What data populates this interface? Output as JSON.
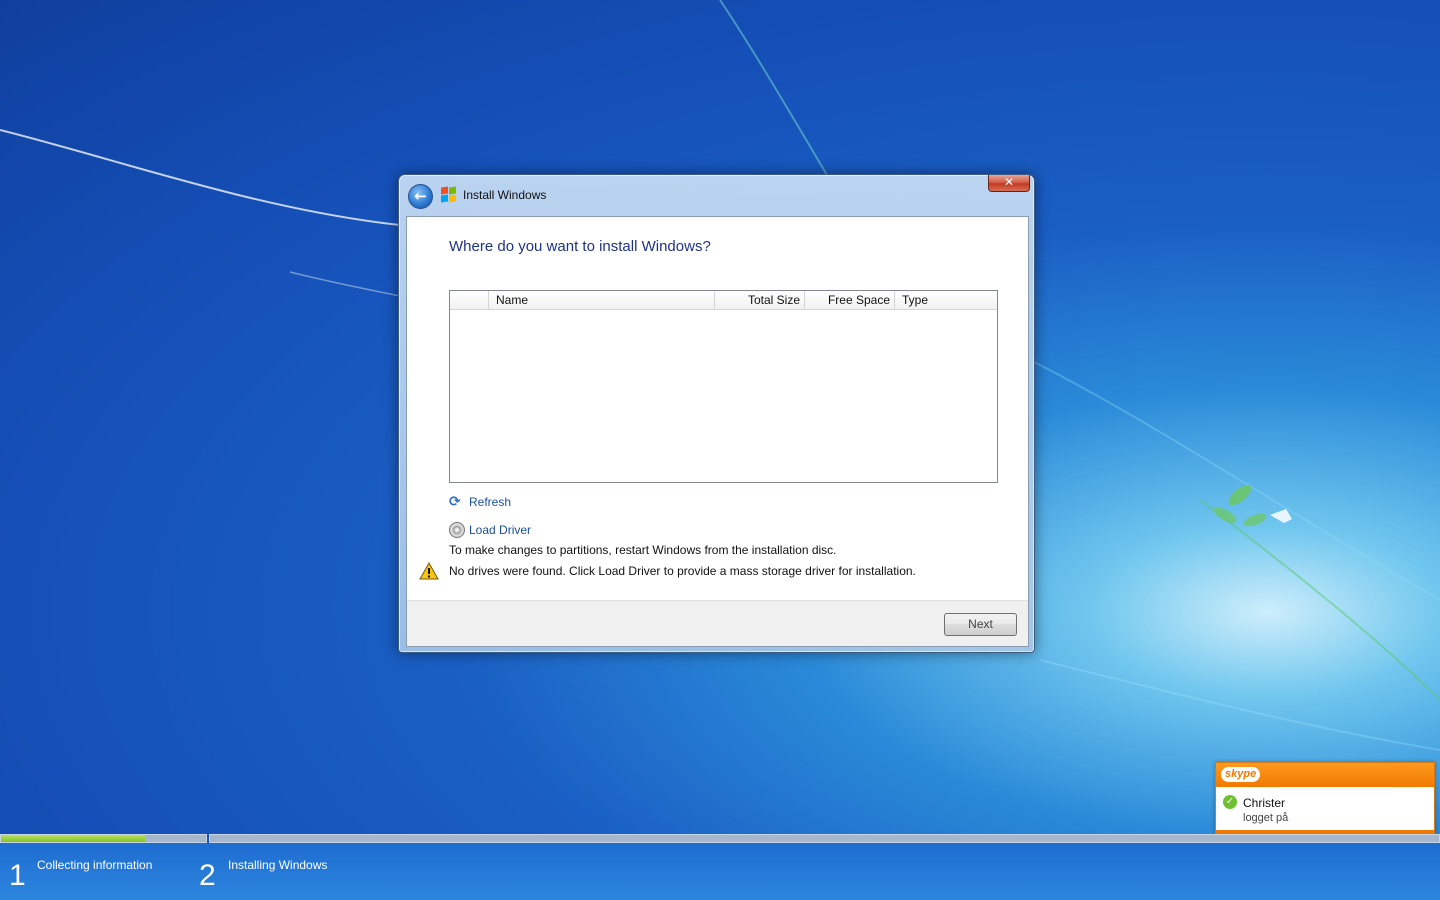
{
  "window": {
    "title": "Install Windows",
    "close_glyph": "✕",
    "back_glyph": "←"
  },
  "page": {
    "heading": "Where do you want to install Windows?",
    "table": {
      "columns": [
        "",
        "Name",
        "Total Size",
        "Free Space",
        "Type"
      ],
      "rows": []
    },
    "refresh_label": "Refresh",
    "load_driver_label": "Load Driver",
    "info_text": "To make changes to partitions, restart Windows from the installation disc.",
    "warning_text": "No drives were found. Click Load Driver to provide a mass storage driver for installation.",
    "next_label": "Next"
  },
  "progress": {
    "steps": [
      {
        "number": "1",
        "label": "Collecting information"
      },
      {
        "number": "2",
        "label": "Installing Windows"
      }
    ],
    "step1_fill": 0.7
  },
  "skype": {
    "logo": "skype",
    "contact_name": "Christer",
    "status": "logget på"
  },
  "colors": {
    "heading": "#1e3287",
    "link": "#1a4d9c",
    "progress_fill": "#7fc326",
    "skype_orange": "#f07a00"
  },
  "icons": [
    "back-arrow-icon",
    "windows-flag-icon",
    "close-icon",
    "refresh-icon",
    "disc-icon",
    "warning-icon",
    "skype-check-icon"
  ]
}
